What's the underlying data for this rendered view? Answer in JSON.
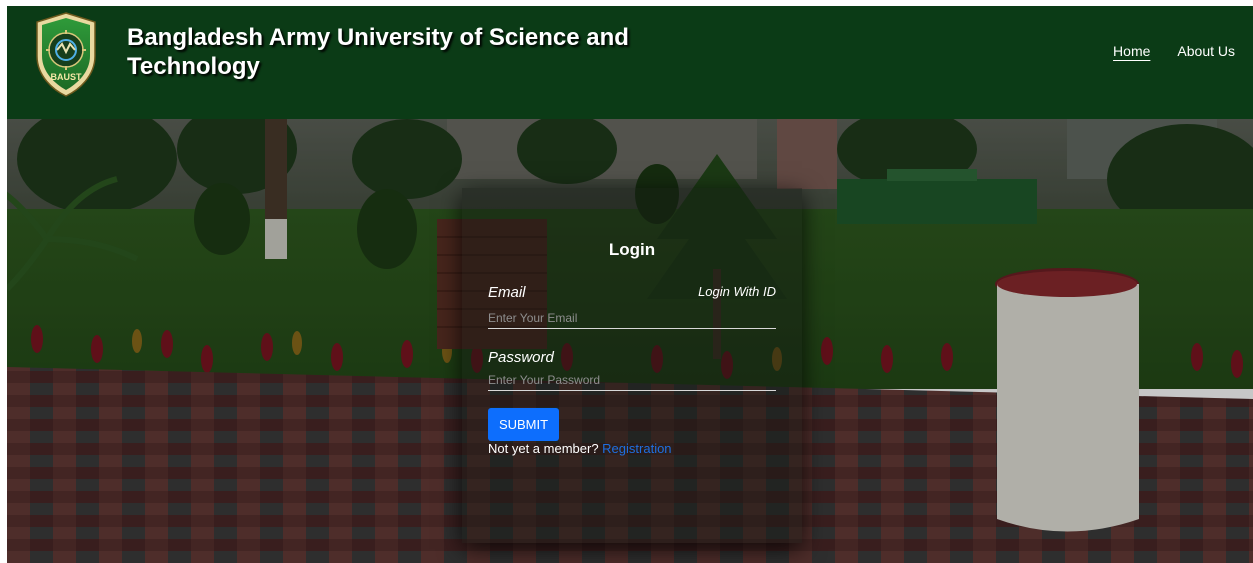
{
  "header": {
    "title": "Bangladesh Army University of Science and Technology",
    "logo_text": "BAUST",
    "nav": [
      {
        "label": "Home",
        "active": true
      },
      {
        "label": "About Us",
        "active": false
      }
    ]
  },
  "login": {
    "title": "Login",
    "email_label": "Email",
    "login_with_id": "Login With ID",
    "email_placeholder": "Enter Your Email",
    "password_label": "Password",
    "password_placeholder": "Enter Your Password",
    "submit_label": "SUBMIT",
    "member_prompt": "Not yet a member?",
    "registration_link": "Registration"
  },
  "colors": {
    "header_bg": "#0b3b16",
    "primary_button": "#0d6efd",
    "link": "#1f6fe0"
  }
}
